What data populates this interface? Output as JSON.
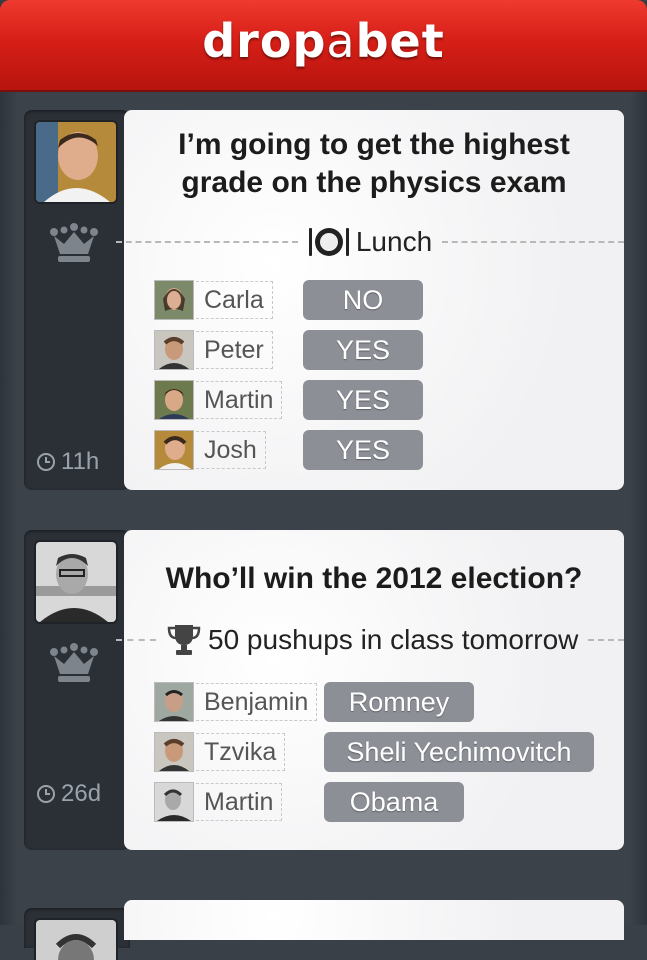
{
  "app": {
    "title_left": "drop",
    "title_mid": "a",
    "title_right": "bet"
  },
  "feed": [
    {
      "time": "11h",
      "question_line1": "I’m going to get the highest",
      "question_line2": "grade on the physics exam",
      "stake": "Lunch",
      "stake_icon": "plate-fork-knife-icon",
      "bets": [
        {
          "name": "Carla",
          "answer": "NO"
        },
        {
          "name": "Peter",
          "answer": "YES"
        },
        {
          "name": "Martin",
          "answer": "YES"
        },
        {
          "name": "Josh",
          "answer": "YES"
        }
      ]
    },
    {
      "time": "26d",
      "question_line1": "Who’ll win the 2012 election?",
      "stake": "50 pushups in class tomorrow",
      "stake_icon": "trophy-icon",
      "bets": [
        {
          "name": "Benjamin",
          "answer": "Romney"
        },
        {
          "name": "Tzvika",
          "answer": "Sheli Yechimovitch"
        },
        {
          "name": "Martin",
          "answer": "Obama"
        }
      ]
    }
  ],
  "colors": {
    "header": "#d61f17",
    "pill": "#8c8f96",
    "background": "#3a4047"
  }
}
